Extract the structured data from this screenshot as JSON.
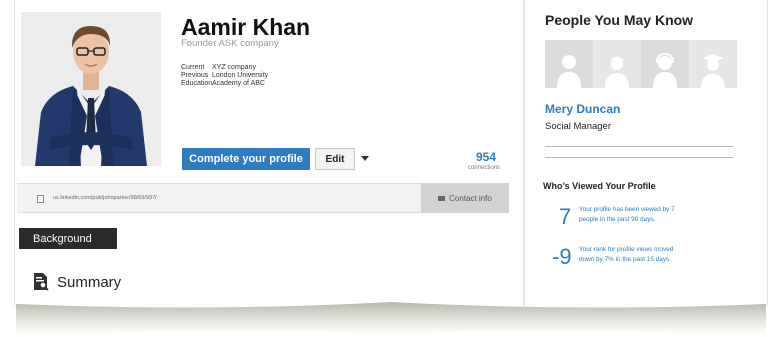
{
  "profile": {
    "name": "Aamir Khan",
    "headline": "Founder ASK company",
    "details": [
      {
        "key": "Current",
        "value": "XYZ company"
      },
      {
        "key": "Previous",
        "value": "London University"
      },
      {
        "key": "Education",
        "value": "Academy of ABC"
      }
    ],
    "complete_button": "Complete your profile",
    "edit_button": "Edit",
    "connections_count": "954",
    "connections_label": "connections",
    "public_url": "us.linkedin.com/pub/johnparker/98/65/937/",
    "contact_info_button": "Contact info",
    "background_tab": "Background",
    "summary_label": "Summary"
  },
  "sidebar": {
    "pymk_title": "People You May Know",
    "suggested_person": {
      "name": "Mery Duncan",
      "role": "Social Manager"
    },
    "avatar_icons": [
      "person-avatar-icon",
      "worker-avatar-icon",
      "headset-avatar-icon",
      "graduate-avatar-icon"
    ],
    "who_viewed_title": "Who’s Viewed Your Profile",
    "stats": [
      {
        "value": "7",
        "text_line1": "Your profile has been viewed by 7",
        "text_line2": "people in the past 90 days."
      },
      {
        "value": "-9",
        "text_line1": "Your rank for profile views moved",
        "text_line2": "down by 7% in the past 15 days."
      }
    ]
  },
  "colors": {
    "accent": "#2d7cc1",
    "dark_tab": "#2b2b2b",
    "avatar_bg": "#dcdcdc"
  }
}
